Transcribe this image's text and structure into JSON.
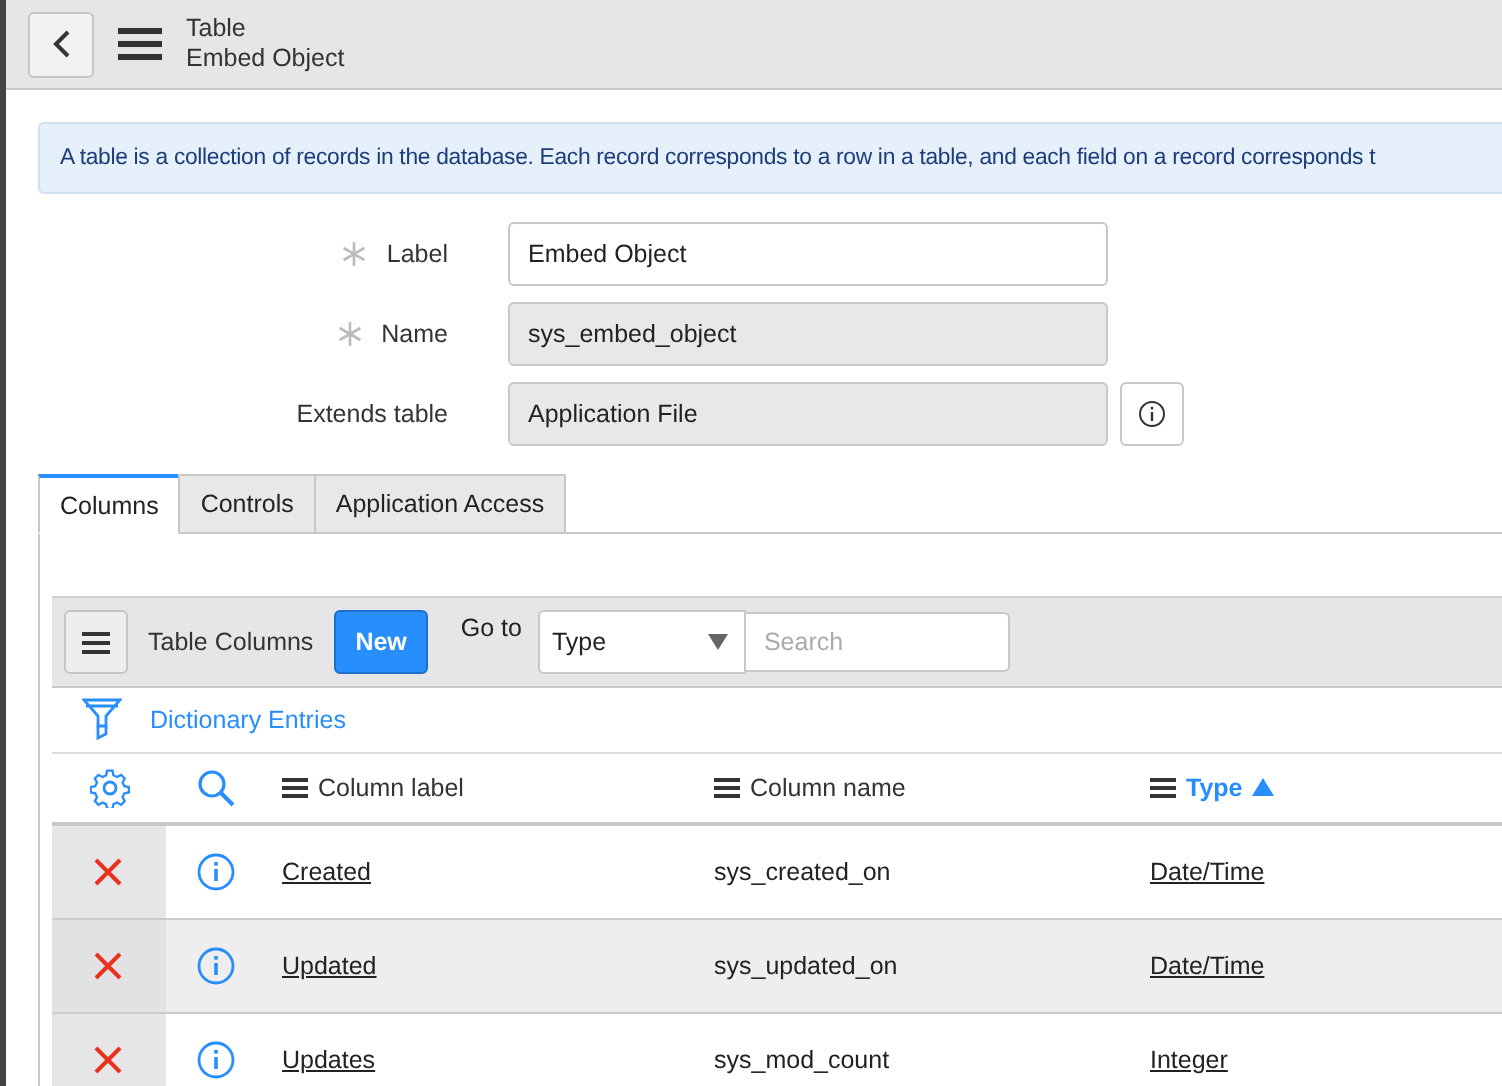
{
  "header": {
    "title": "Table",
    "subtitle": "Embed Object"
  },
  "info": "A table is a collection of records in the database. Each record corresponds to a row in a table, and each field on a record corresponds t",
  "form": [
    {
      "label": "Label",
      "required": true,
      "value": "Embed Object",
      "readonly": false,
      "info_button": false
    },
    {
      "label": "Name",
      "required": true,
      "value": "sys_embed_object",
      "readonly": true,
      "info_button": false
    },
    {
      "label": "Extends table",
      "required": false,
      "value": "Application File",
      "readonly": true,
      "info_button": true
    }
  ],
  "tabs": [
    {
      "label": "Columns",
      "selected": true
    },
    {
      "label": "Controls",
      "selected": false
    },
    {
      "label": "Application Access",
      "selected": false
    }
  ],
  "list": {
    "title": "Table Columns",
    "new_button": "New",
    "goto_label": "Go to",
    "goto_select": "Type",
    "search_placeholder": "Search",
    "breadcrumb": "Dictionary Entries",
    "columns": [
      {
        "label": "Column label",
        "sorted": false
      },
      {
        "label": "Column name",
        "sorted": false
      },
      {
        "label": "Type",
        "sorted": true
      }
    ],
    "rows": [
      {
        "label": "Created",
        "name": "sys_created_on",
        "type": "Date/Time"
      },
      {
        "label": "Updated",
        "name": "sys_updated_on",
        "type": "Date/Time"
      },
      {
        "label": "Updates",
        "name": "sys_mod_count",
        "type": "Integer"
      }
    ]
  }
}
